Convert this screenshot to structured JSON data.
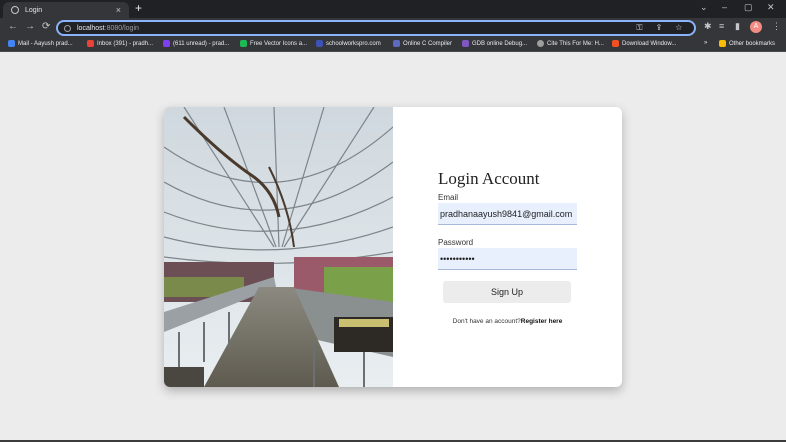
{
  "browser": {
    "tab_title": "Login",
    "tab_close": "×",
    "new_tab": "+",
    "url_host": "localhost",
    "url_path": ":8080/login",
    "profile_initial": "A",
    "window_controls": [
      "⌄",
      "–",
      "▢",
      "✕"
    ],
    "bookmarks": [
      {
        "label": "Mail - Aayush prad...",
        "color": "#4285f4"
      },
      {
        "label": "Inbox (391) - pradh...",
        "color": "#ea4335"
      },
      {
        "label": "(611 unread) - prad...",
        "color": "#7e3ff2"
      },
      {
        "label": "Free Vector Icons a...",
        "color": "#1db954"
      },
      {
        "label": "schoolworkspro.com",
        "color": "#3f51b5"
      },
      {
        "label": "Online C Compiler",
        "color": "#5c6bc0"
      },
      {
        "label": "GDB online Debug...",
        "color": "#7e57c2"
      },
      {
        "label": "Cite This For Me: H...",
        "color": "#9e9e9e"
      },
      {
        "label": "Download Window...",
        "color": "#f25022"
      }
    ],
    "bookmarks_overflow": "»",
    "other_bookmarks": "Other bookmarks"
  },
  "login": {
    "title": "Login Account",
    "email_label": "Email",
    "email_value": "pradhanaayush9841@gmail.com",
    "password_label": "Password",
    "password_value": "•••••••••••",
    "submit_label": "Sign Up",
    "register_prompt": "Don't have an account?",
    "register_link": "Register here"
  }
}
